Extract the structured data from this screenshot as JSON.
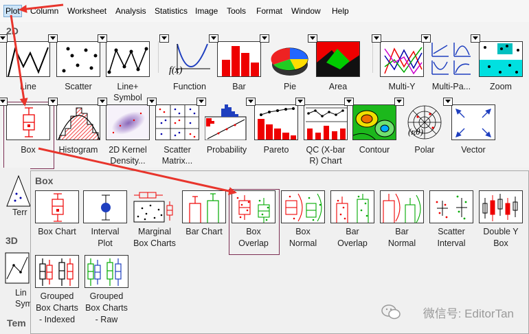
{
  "menubar": {
    "items": [
      {
        "label": "Plot",
        "active": true
      },
      {
        "label": "Column"
      },
      {
        "label": "Worksheet"
      },
      {
        "label": "Analysis"
      },
      {
        "label": "Statistics"
      },
      {
        "label": "Image"
      },
      {
        "label": "Tools"
      },
      {
        "label": "Format"
      },
      {
        "label": "Window"
      },
      {
        "label": "Help"
      }
    ]
  },
  "section_2d": {
    "title": "2D",
    "row1": [
      "Line",
      "Scatter",
      "Line+\nSymbol",
      "Function",
      "Bar",
      "Pie",
      "Area",
      "Multi-Y",
      "Multi-Pa...",
      "Zoom"
    ],
    "row2": [
      "Box",
      "Histogram",
      "2D Kernel\nDensity...",
      "Scatter\nMatrix...",
      "Probability",
      "Pareto",
      "QC (X-bar\nR) Chart",
      "Contour",
      "Polar",
      "Vector"
    ]
  },
  "left_strip": {
    "terr": "Terr",
    "title_3d": "3D",
    "lin_sym": "Lin\nSym",
    "tem": "Tem"
  },
  "box_submenu": {
    "title": "Box",
    "row1": [
      "Box Chart",
      "Interval\nPlot",
      "Marginal\nBox Charts",
      "Bar Chart",
      "Box\nOverlap",
      "Box\nNormal",
      "Bar\nOverlap",
      "Bar\nNormal",
      "Scatter\nInterval",
      "Double Y\nBox"
    ],
    "row2": [
      "Grouped\nBox Charts\n- Indexed",
      "Grouped\nBox Charts\n- Raw"
    ]
  },
  "watermark": {
    "text": "微信号: EditorTan"
  },
  "colors": {
    "annotation_arrow": "#e8352c",
    "selection_border": "#7b2d52",
    "menu_highlight": "#cce4f7"
  }
}
